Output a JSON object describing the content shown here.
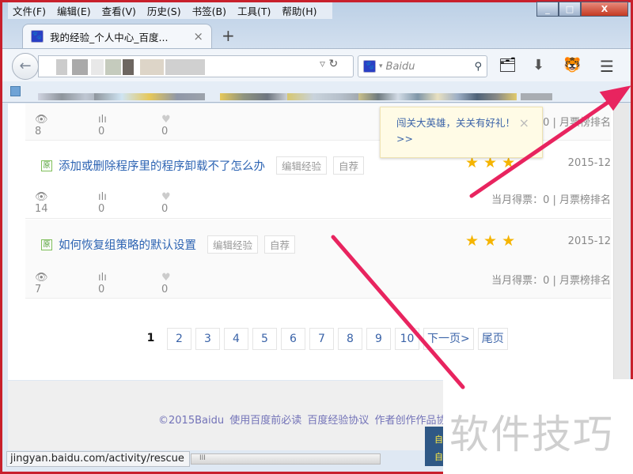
{
  "menu": [
    "文件(F)",
    "编辑(E)",
    "查看(V)",
    "历史(S)",
    "书签(B)",
    "工具(T)",
    "帮助(H)"
  ],
  "window_buttons": {
    "minimize": "_",
    "maximize": "□",
    "close": "X"
  },
  "tab": {
    "title": "我的经验_个人中心_百度...",
    "close": "×",
    "new": "+"
  },
  "search": {
    "placeholder": "Baidu"
  },
  "bookmarks_more": "»",
  "rows": [
    {
      "title": "",
      "views": "8",
      "bars": "0",
      "likes": "0",
      "vote": "0 | 月票榜排名"
    },
    {
      "title": "添加或删除程序里的程序卸载不了怎么办",
      "edit": "编辑经验",
      "recommend": "自荐",
      "date": "2015-12",
      "views": "14",
      "bars": "0",
      "likes": "0",
      "vote": "当月得票：0 | 月票榜排名",
      "stars": 3
    },
    {
      "title": "如何恢复组策略的默认设置",
      "edit": "编辑经验",
      "recommend": "自荐",
      "date": "2015-12",
      "views": "7",
      "bars": "0",
      "likes": "0",
      "vote": "当月得票：0 | 月票榜排名",
      "stars": 3
    }
  ],
  "original_badge": "原",
  "popup": {
    "text": "闯关大英雄，关关有好礼！ >>",
    "close": "×"
  },
  "pager": {
    "current": "1",
    "pages": [
      "2",
      "3",
      "4",
      "5",
      "6",
      "7",
      "8",
      "9",
      "10"
    ],
    "next": "下一页>",
    "last": "尾页"
  },
  "footer": "©2015Baidu 使用百度前必读 百度经验协议 作者创作作品协",
  "status_url": "jingyan.baidu.com/activity/rescue",
  "side_box": "自 自",
  "watermark": "软件技巧",
  "colors": {
    "frame": "#c8202c",
    "link": "#2d64b3",
    "star": "#f5b400",
    "arrow": "#e8245f"
  }
}
